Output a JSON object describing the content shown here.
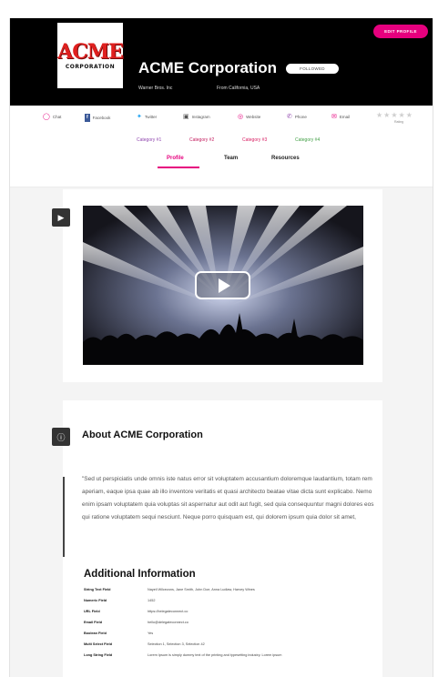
{
  "header": {
    "company_name": "ACME Corporation",
    "logo_top": "ACME",
    "logo_bottom": "CORPORATION",
    "followed_label": "FOLLOWED",
    "edit_profile_label": "EDIT PROFILE",
    "subtitle_left": "Warner Bros. Inc",
    "subtitle_right": "From California, USA"
  },
  "social": {
    "items": [
      {
        "label": "Chat",
        "icon": "chat-icon"
      },
      {
        "label": "Facebook",
        "icon": "facebook-icon"
      },
      {
        "label": "Twitter",
        "icon": "twitter-icon"
      },
      {
        "label": "Instagram",
        "icon": "instagram-icon"
      },
      {
        "label": "Website",
        "icon": "globe-icon"
      },
      {
        "label": "Phone",
        "icon": "phone-icon"
      },
      {
        "label": "Email",
        "icon": "email-icon"
      }
    ],
    "rating_label": "Rating",
    "rating_stars": "★★★★★"
  },
  "categories": [
    "Category #1",
    "Category #2",
    "Category #3",
    "Category #4"
  ],
  "tabs": {
    "profile": "Profile",
    "team": "Team",
    "resources": "Resources"
  },
  "about": {
    "title": "About ACME Corporation",
    "text": "\"Sed ut perspiciatis unde omnis iste natus error sit voluptatem accusantium doloremque laudantium, totam rem aperiam, eaque ipsa quae ab illo inventore veritatis et quasi architecto beatae vitae dicta sunt explicabo. Nemo enim ipsam voluptatem quia voluptas sit aspernatur aut odit aut fugit, sed quia consequuntur magni dolores eos qui ratione voluptatem sequi nesciunt. Neque porro quisquam est, qui dolorem ipsum quia dolor sit amet,"
  },
  "additional": {
    "title": "Additional Information",
    "fields": [
      {
        "label": "String Text Field",
        "value": "Nayeli Wilcezons, Jane Smith, John Doe, Anna Ludlaw, Harvey Wines"
      },
      {
        "label": "Numeric Field",
        "value": "1452"
      },
      {
        "label": "URL Field",
        "value": "https://belegateconnect.co"
      },
      {
        "label": "Email Field",
        "value": "hello@delegateconnect.co"
      },
      {
        "label": "Boolean Field",
        "value": "Yes"
      },
      {
        "label": "Multi Select Field",
        "value": "Selection 1, Selection 3, Selection 42"
      },
      {
        "label": "Long String Field",
        "value": "Lorem Ipsum is simply dummy text of the printing and typesetting industry. Lorem ipsum"
      }
    ]
  },
  "colors": {
    "accent": "#e6007e",
    "header_bg": "#000000",
    "category_1": "#8e44ad",
    "category_2": "#c2185b",
    "category_3": "#d81b60",
    "category_4": "#43a047"
  }
}
